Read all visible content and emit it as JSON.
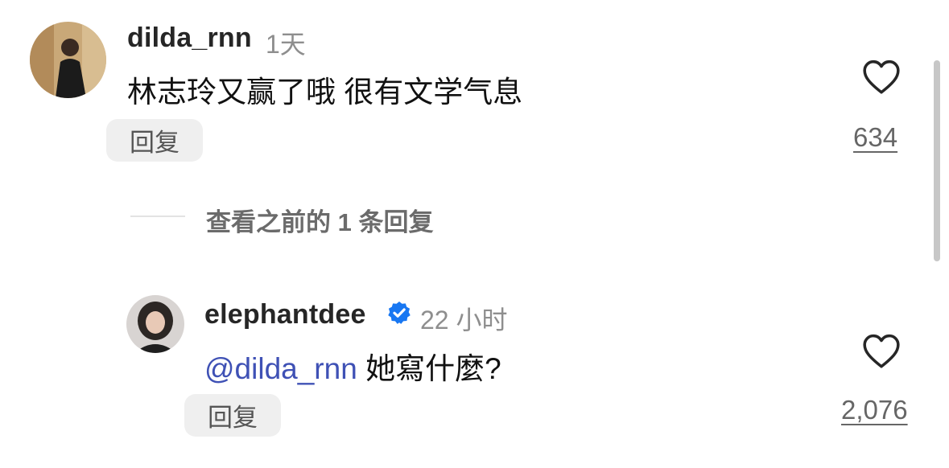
{
  "comments": [
    {
      "username": "dilda_rnn",
      "time": "1天",
      "text": "林志玲又赢了哦 很有文学气息",
      "reply_label": "回复",
      "like_count": "634"
    }
  ],
  "view_more_replies": "查看之前的 1 条回复",
  "reply": {
    "username": "elephantdee",
    "verified": true,
    "time": "22 小时",
    "mention": "@dilda_rnn",
    "text": "她寫什麼?",
    "reply_label": "回复",
    "like_count": "2,076"
  },
  "icons": [
    "heart-icon",
    "verified-badge-icon"
  ],
  "colors": {
    "mention": "#3f51b5",
    "verified": "#1877f2"
  }
}
